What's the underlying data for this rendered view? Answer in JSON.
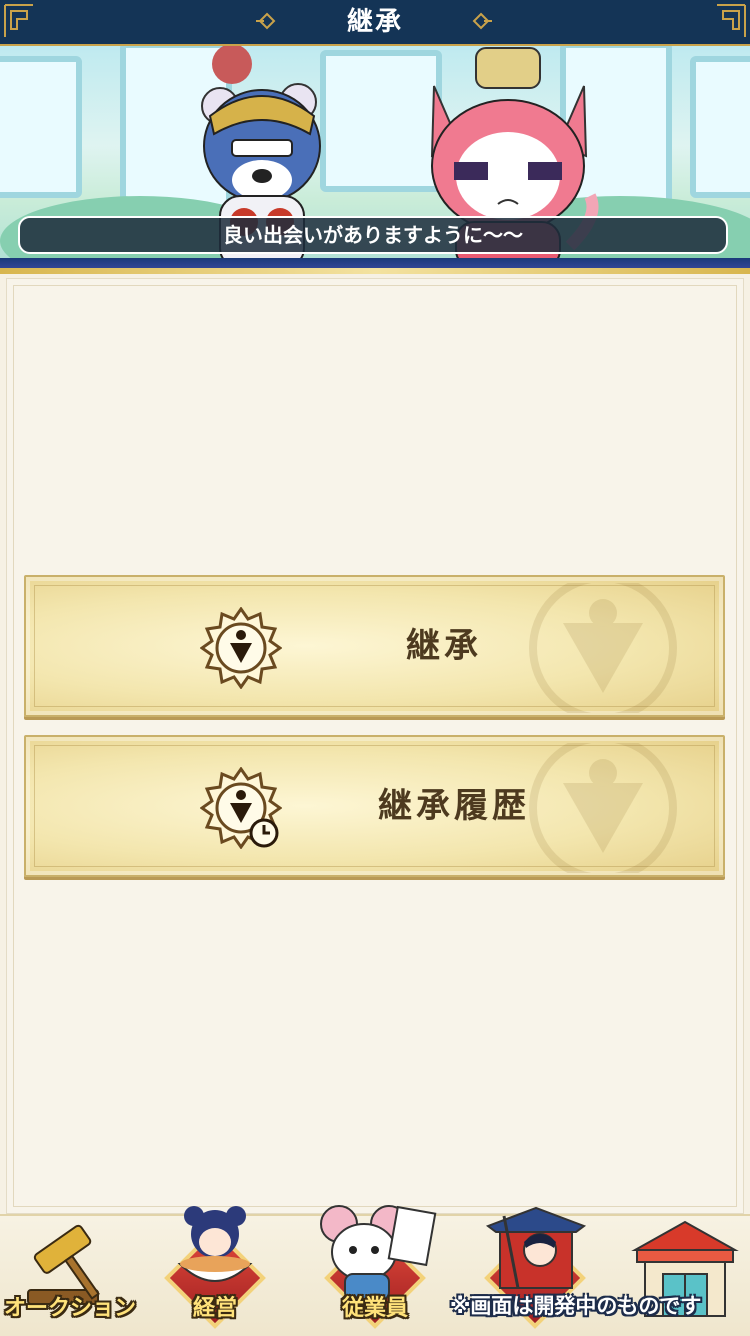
{
  "header": {
    "title": "継承"
  },
  "banner": {
    "speech": "良い出会いがありますように〜〜"
  },
  "menu": {
    "items": [
      {
        "label": "継承",
        "icon": "inherit-emblem-icon"
      },
      {
        "label": "継承履歴",
        "icon": "inherit-history-emblem-icon"
      }
    ]
  },
  "nav": {
    "items": [
      {
        "label": "オークション",
        "icon": "gavel-icon"
      },
      {
        "label": "経営",
        "icon": "ramen-girl-icon"
      },
      {
        "label": "従業員",
        "icon": "mouse-staff-icon"
      },
      {
        "label": "",
        "icon": "warrior-gate-icon"
      },
      {
        "label": "",
        "icon": "shop-building-icon"
      }
    ],
    "dev_note": "※画面は開発中のものです"
  },
  "colors": {
    "header_bg": "#143456",
    "button_gold": "#f3e6ae",
    "text_brown": "#4d3a1f",
    "accent_red": "#c8322a"
  }
}
